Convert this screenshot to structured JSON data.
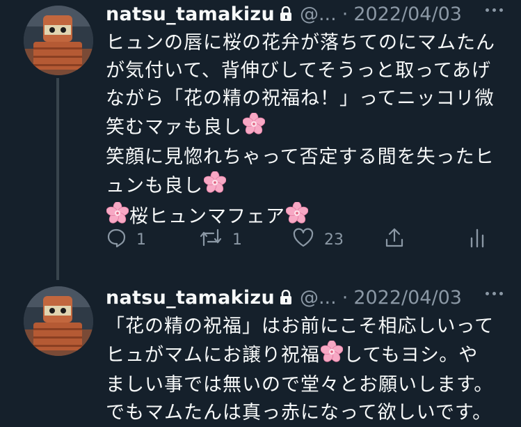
{
  "tweets": [
    {
      "display_name": "natsu_tamakizu",
      "handle": "@...",
      "separator": "·",
      "date": "2022/04/03",
      "lines": [
        [
          "ヒュンの唇に桜の花弁が落ちてのにマムたん"
        ],
        [
          "が気付いて、背伸びしてそうっと取ってあげ"
        ],
        [
          "ながら「花の精の祝福ね！」ってニッコリ微"
        ],
        [
          "笑むマァも良し"
        ],
        [
          "笑顔に見惚れちゃって否定する間を失ったヒ"
        ],
        [
          "ュンも良し"
        ],
        [
          "",
          "桜ヒュンマフェア"
        ]
      ],
      "reply_count": "1",
      "retweet_count": "1",
      "like_count": "23"
    },
    {
      "display_name": "natsu_tamakizu",
      "handle": "@...",
      "separator": "·",
      "date": "2022/04/03",
      "lines": [
        [
          "「花の精の祝福」はお前にこそ相応しいって"
        ],
        [
          "ヒュがマムにお譲り祝福",
          "してもヨシ。や"
        ],
        [
          "ましい事では無いので堂々とお願いします。"
        ],
        [
          "でもマムたんは真っ赤になって欲しいです。"
        ]
      ]
    }
  ],
  "icons": {
    "lock": "lock-icon",
    "emoji": "cherry-blossom-icon",
    "reply": "reply-icon",
    "retweet": "retweet-icon",
    "like": "heart-icon",
    "share": "share-icon",
    "analytics": "analytics-icon",
    "more": "more-icon"
  },
  "colors": {
    "background": "#15202b",
    "text": "#f7f9f9",
    "secondary": "#8b98a5",
    "thread_line": "#38444d",
    "blossom": "#f7a8c4"
  }
}
